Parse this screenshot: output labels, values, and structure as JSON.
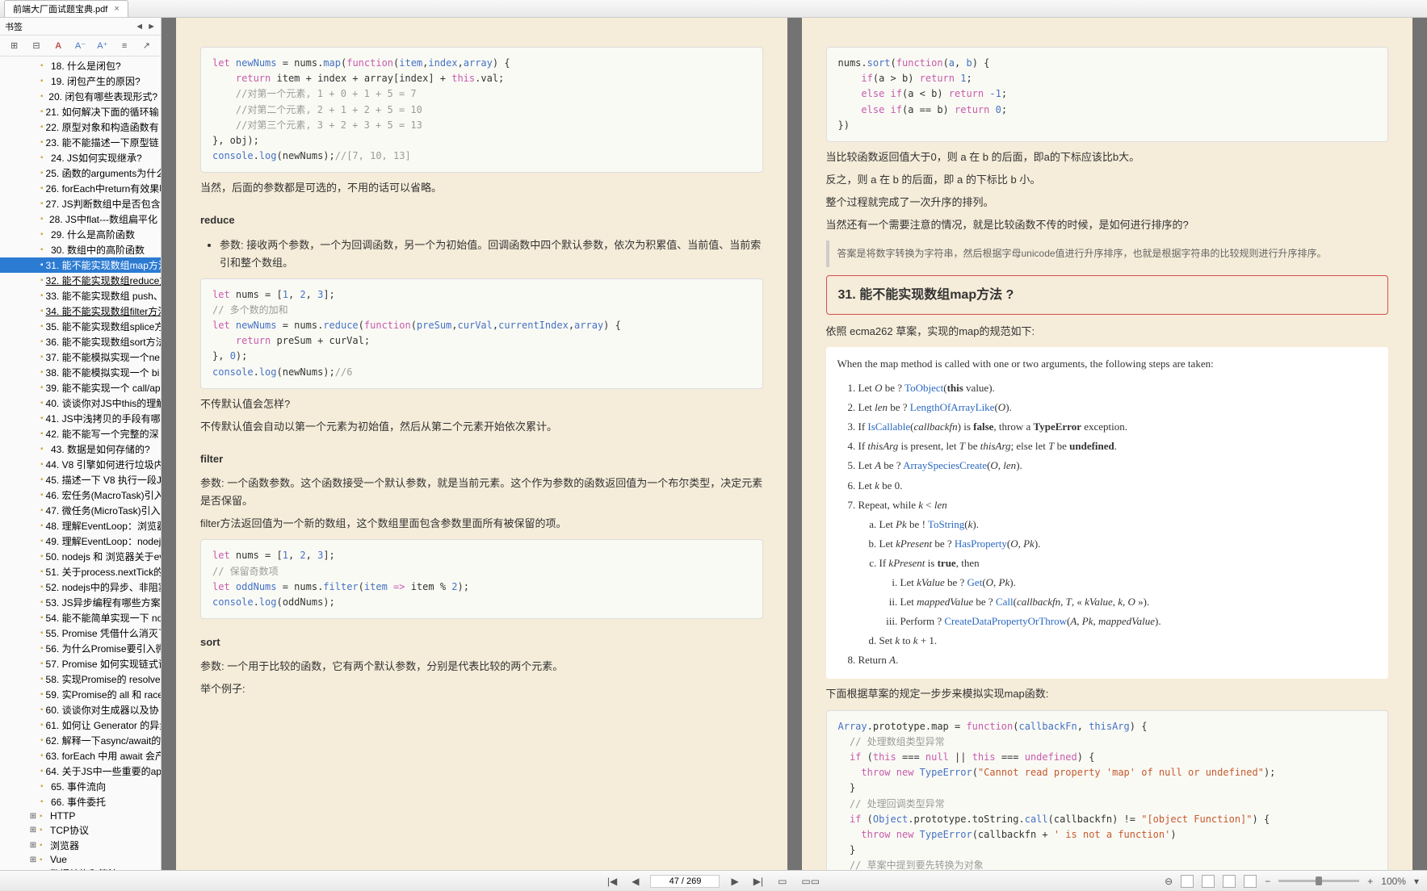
{
  "tab": {
    "title": "前端大厂面试题宝典.pdf",
    "close": "×"
  },
  "sidebar": {
    "title": "书签",
    "tools": [
      "□",
      "⊡",
      "A",
      "A⁻",
      "A⁺",
      "☰",
      "⤴"
    ],
    "items": [
      {
        "n": "18.",
        "t": "什么是闭包?",
        "lvl": 2
      },
      {
        "n": "19.",
        "t": "闭包产生的原因?",
        "lvl": 2
      },
      {
        "n": "20.",
        "t": "闭包有哪些表现形式?",
        "lvl": 2
      },
      {
        "n": "21.",
        "t": "如何解决下面的循环输",
        "lvl": 2
      },
      {
        "n": "22.",
        "t": "原型对象和构造函数有",
        "lvl": 2
      },
      {
        "n": "23.",
        "t": "能不能描述一下原型链",
        "lvl": 2
      },
      {
        "n": "24.",
        "t": "JS如何实现继承?",
        "lvl": 2
      },
      {
        "n": "25.",
        "t": "函数的arguments为什么",
        "lvl": 2
      },
      {
        "n": "26.",
        "t": "forEach中return有效果吗",
        "lvl": 2
      },
      {
        "n": "27.",
        "t": "JS判断数组中是否包含",
        "lvl": 2
      },
      {
        "n": "28.",
        "t": "JS中flat---数组扁平化",
        "lvl": 2
      },
      {
        "n": "29.",
        "t": "什么是高阶函数",
        "lvl": 2
      },
      {
        "n": "30.",
        "t": "数组中的高阶函数",
        "lvl": 2
      },
      {
        "n": "31.",
        "t": "能不能实现数组map方法",
        "lvl": 2,
        "sel": true
      },
      {
        "n": "32.",
        "t": "能不能实现数组reduce方",
        "lvl": 2,
        "u": true
      },
      {
        "n": "33.",
        "t": "能不能实现数组 push、",
        "lvl": 2
      },
      {
        "n": "34.",
        "t": "能不能实现数组filter方法",
        "lvl": 2,
        "u": true
      },
      {
        "n": "35.",
        "t": "能不能实现数组splice方",
        "lvl": 2
      },
      {
        "n": "36.",
        "t": "能不能实现数组sort方法",
        "lvl": 2
      },
      {
        "n": "37.",
        "t": "能不能模拟实现一个ne",
        "lvl": 2
      },
      {
        "n": "38.",
        "t": "能不能模拟实现一个 bi",
        "lvl": 2
      },
      {
        "n": "39.",
        "t": "能不能实现一个 call/ap",
        "lvl": 2
      },
      {
        "n": "40.",
        "t": "谈谈你对JS中this的理解",
        "lvl": 2
      },
      {
        "n": "41.",
        "t": "JS中浅拷贝的手段有哪",
        "lvl": 2
      },
      {
        "n": "42.",
        "t": "能不能写一个完整的深",
        "lvl": 2
      },
      {
        "n": "43.",
        "t": "数据是如何存储的?",
        "lvl": 2
      },
      {
        "n": "44.",
        "t": "V8 引擎如何进行垃圾内",
        "lvl": 2
      },
      {
        "n": "45.",
        "t": "描述一下 V8 执行一段J",
        "lvl": 2
      },
      {
        "n": "46.",
        "t": "宏任务(MacroTask)引入",
        "lvl": 2
      },
      {
        "n": "47.",
        "t": "微任务(MicroTask)引入",
        "lvl": 2
      },
      {
        "n": "48.",
        "t": "理解EventLoop：浏览器",
        "lvl": 2
      },
      {
        "n": "49.",
        "t": "理解EventLoop：nodejs",
        "lvl": 2
      },
      {
        "n": "50.",
        "t": "nodejs 和 浏览器关于ev",
        "lvl": 2
      },
      {
        "n": "51.",
        "t": "关于process.nextTick的一",
        "lvl": 2
      },
      {
        "n": "52.",
        "t": "nodejs中的异步、非阻塞",
        "lvl": 2
      },
      {
        "n": "53.",
        "t": "JS异步编程有哪些方案",
        "lvl": 2
      },
      {
        "n": "54.",
        "t": "能不能简单实现一下 no",
        "lvl": 2
      },
      {
        "n": "55.",
        "t": "Promise 凭借什么消灭了",
        "lvl": 2
      },
      {
        "n": "56.",
        "t": "为什么Promise要引入微",
        "lvl": 2
      },
      {
        "n": "57.",
        "t": "Promise 如何实现链式调",
        "lvl": 2
      },
      {
        "n": "58.",
        "t": "实现Promise的 resolve、",
        "lvl": 2
      },
      {
        "n": "59.",
        "t": "实Promise的 all 和 race",
        "lvl": 2
      },
      {
        "n": "60.",
        "t": "谈谈你对生成器以及协",
        "lvl": 2
      },
      {
        "n": "61.",
        "t": "如何让 Generator 的异步",
        "lvl": 2
      },
      {
        "n": "62.",
        "t": "解释一下async/await的",
        "lvl": 2
      },
      {
        "n": "63.",
        "t": "forEach 中用 await 会产生",
        "lvl": 2
      },
      {
        "n": "64.",
        "t": "关于JS中一些重要的api",
        "lvl": 2
      },
      {
        "n": "65.",
        "t": "事件流向",
        "lvl": 2
      },
      {
        "n": "66.",
        "t": "事件委托",
        "lvl": 2
      },
      {
        "n": "",
        "t": "HTTP",
        "lvl": 1,
        "plus": true
      },
      {
        "n": "",
        "t": "TCP协议",
        "lvl": 1,
        "plus": true
      },
      {
        "n": "",
        "t": "浏览器",
        "lvl": 1,
        "plus": true
      },
      {
        "n": "",
        "t": "Vue",
        "lvl": 1,
        "plus": true
      },
      {
        "n": "",
        "t": "数据结构和算法",
        "lvl": 1,
        "plus": true
      }
    ]
  },
  "left_page": {
    "text1": "当然，后面的参数都是可选的，不用的话可以省略。",
    "h_reduce": "reduce",
    "reduce_bullet": "参数: 接收两个参数，一个为回调函数，另一个为初始值。回调函数中四个默认参数，依次为积累值、当前值、当前索引和整个数组。",
    "no_init1": "不传默认值会怎样?",
    "no_init2": "不传默认值会自动以第一个元素为初始值，然后从第二个元素开始依次累计。",
    "h_filter": "filter",
    "filter_p1": "参数: 一个函数参数。这个函数接受一个默认参数，就是当前元素。这个作为参数的函数返回值为一个布尔类型，决定元素是否保留。",
    "filter_p2": "filter方法返回值为一个新的数组，这个数组里面包含参数里面所有被保留的项。",
    "h_sort": "sort",
    "sort_p": "参数: 一个用于比较的函数，它有两个默认参数，分别是代表比较的两个元素。",
    "sort_ex": "举个例子:"
  },
  "right_page": {
    "p1": "当比较函数返回值大于0，则 a 在 b 的后面，即a的下标应该比b大。",
    "p2": "反之，则 a 在 b 的后面，即 a 的下标比 b 小。",
    "p3": "整个过程就完成了一次升序的排列。",
    "p4": "当然还有一个需要注意的情况，就是比较函数不传的时候，是如何进行排序的?",
    "quote": "答案是将数字转换为字符串，然后根据字母unicode值进行升序排序，也就是根据字符串的比较规则进行升序排序。",
    "box_title": "31. 能不能实现数组map方法 ?",
    "spec_intro": "依照 ecma262 草案，实现的map的规范如下:",
    "spec_head": "When the map method is called with one or two arguments, the following steps are taken:",
    "final": "下面根据草案的规定一步步来模拟实现map函数:"
  },
  "status": {
    "page_field": "47 / 269",
    "zoom": "100%"
  }
}
